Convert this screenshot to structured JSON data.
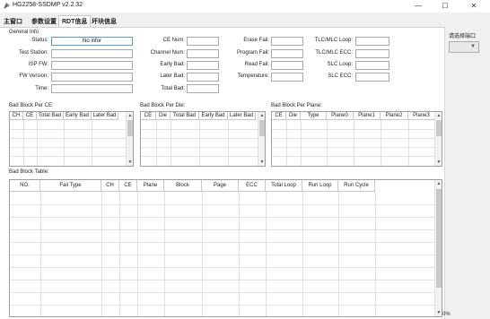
{
  "window": {
    "title": "HG2258-SSDMP v2.2.32",
    "minimize_glyph": "—",
    "maximize_glyph": "☐",
    "close_glyph": "✕"
  },
  "tabs": [
    {
      "label": "主窗口"
    },
    {
      "label": "参数设置"
    },
    {
      "label": "RDT信息"
    },
    {
      "label": "坏块信息"
    }
  ],
  "general_info": {
    "title": "General Info",
    "status_label": "Status:",
    "status_value": "No infor",
    "test_station_label": "Test Station:",
    "isp_fw_label": "ISP FW:",
    "fw_version_label": "FW Version:",
    "time_label": "Time:",
    "ce_num_label": "CE Num:",
    "channel_num_label": "Channel Num:",
    "early_bad_label": "Early Bad:",
    "later_bad_label": "Later Bad:",
    "total_bad_label": "Total Bad:",
    "erase_fail_label": "Erase Fail:",
    "program_fail_label": "Program Fail:",
    "read_fail_label": "Read Fail:",
    "temperature_label": "Temperature:",
    "tlc_mlc_loop_label": "TLC/MLC Loop:",
    "tlc_mlc_ecc_label": "TLC/MLC ECC:",
    "slc_loop_label": "SLC Loop:",
    "slc_ecc_label": "SLC ECC:"
  },
  "bad_block_per_ce": {
    "title": "Bad Block Per CE:",
    "columns": [
      "CH",
      "CE",
      "Total Bad",
      "Early Bad",
      "Later Bad"
    ]
  },
  "bad_block_per_die": {
    "title": "Bad Block Per Die:",
    "columns": [
      "CE",
      "Die",
      "Total Bad",
      "Early Bad",
      "Later Bad"
    ]
  },
  "bad_block_per_plane": {
    "title": "Bad Block Per Plane:",
    "columns": [
      "CE",
      "Die",
      "Type",
      "Plane0",
      "Plane1",
      "Plane2",
      "Plane3"
    ]
  },
  "bad_block_table": {
    "title": "Bad Block Table:",
    "columns": [
      "NO.",
      "Fail Type",
      "CH",
      "CE",
      "Plane",
      "Block",
      "Page",
      "ECC",
      "Total Loop",
      "Run Loop",
      "Run Cycle"
    ]
  },
  "side_panel": {
    "port_label": "请选择端口",
    "port_value": ""
  },
  "progress": {
    "text": "0%"
  }
}
